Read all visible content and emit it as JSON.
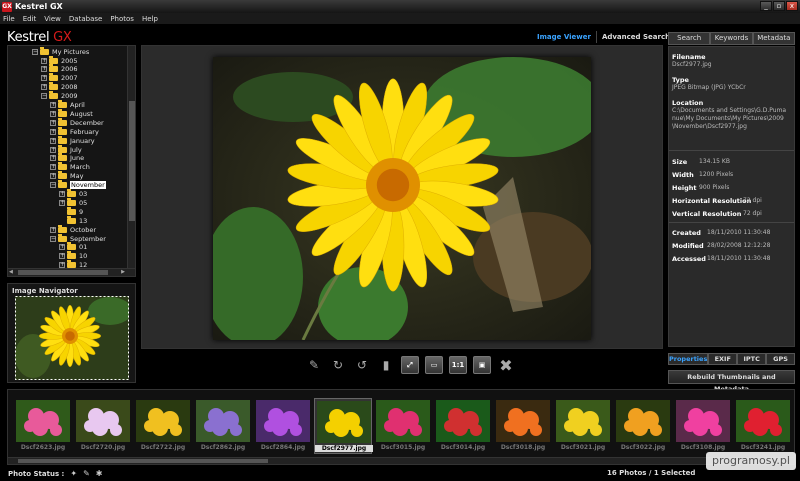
{
  "window": {
    "title": "Kestrel GX",
    "icon_text": "GX",
    "controls": [
      "_",
      "▫",
      "x"
    ]
  },
  "menu": [
    "File",
    "Edit",
    "View",
    "Database",
    "Photos",
    "Help"
  ],
  "logo": {
    "main": "Kestrel ",
    "accent": "GX"
  },
  "view_tabs": [
    {
      "label": "Image Viewer",
      "active": true
    },
    {
      "label": "Advanced Search",
      "active": false
    }
  ],
  "tree": {
    "root": "My Pictures",
    "items": [
      {
        "label": "2005",
        "level": 1,
        "exp": "+"
      },
      {
        "label": "2006",
        "level": 1,
        "exp": "+"
      },
      {
        "label": "2007",
        "level": 1,
        "exp": "+"
      },
      {
        "label": "2008",
        "level": 1,
        "exp": "+"
      },
      {
        "label": "2009",
        "level": 1,
        "exp": "−"
      },
      {
        "label": "April",
        "level": 2,
        "exp": "+"
      },
      {
        "label": "August",
        "level": 2,
        "exp": "+"
      },
      {
        "label": "December",
        "level": 2,
        "exp": "+"
      },
      {
        "label": "February",
        "level": 2,
        "exp": "+"
      },
      {
        "label": "January",
        "level": 2,
        "exp": "+"
      },
      {
        "label": "July",
        "level": 2,
        "exp": "+"
      },
      {
        "label": "June",
        "level": 2,
        "exp": "+"
      },
      {
        "label": "March",
        "level": 2,
        "exp": "+"
      },
      {
        "label": "May",
        "level": 2,
        "exp": "+"
      },
      {
        "label": "November",
        "level": 2,
        "exp": "−",
        "selected": true
      },
      {
        "label": "03",
        "level": 3,
        "exp": "+"
      },
      {
        "label": "05",
        "level": 3,
        "exp": "+"
      },
      {
        "label": "9",
        "level": 3,
        "exp": ""
      },
      {
        "label": "13",
        "level": 3,
        "exp": ""
      },
      {
        "label": "October",
        "level": 2,
        "exp": "+"
      },
      {
        "label": "September",
        "level": 2,
        "exp": "−"
      },
      {
        "label": "01",
        "level": 3,
        "exp": "+"
      },
      {
        "label": "10",
        "level": 3,
        "exp": "+"
      },
      {
        "label": "12",
        "level": 3,
        "exp": "+"
      }
    ]
  },
  "navigator": {
    "title": "Image Navigator"
  },
  "right_tabs": [
    "Search",
    "Keywords",
    "Metadata"
  ],
  "properties": {
    "filename_label": "Filename",
    "filename": "Dscf2977.jpg",
    "type_label": "Type",
    "type": "JPEG Bitmap (JPG) YCbCr",
    "location_label": "Location",
    "location": "C:\\Documents and Settings\\G.D.Pumanue\\My Documents\\My Pictures\\2009\\November\\Dscf2977.jpg",
    "size_label": "Size",
    "size": "134.15 KB",
    "width_label": "Width",
    "width": "1200 Pixels",
    "height_label": "Height",
    "height": "900 Pixels",
    "hres_label": "Horizontal Resolution",
    "hres": "72 dpi",
    "vres_label": "Vertical Resolution",
    "vres": "72 dpi",
    "created_label": "Created",
    "created": "18/11/2010 11:30:48",
    "modified_label": "Modified",
    "modified": "28/02/2008 12:12:28",
    "accessed_label": "Accessed",
    "accessed": "18/11/2010 11:30:48"
  },
  "bottom_tabs": [
    {
      "label": "Properties",
      "active": true
    },
    {
      "label": "EXIF",
      "active": false
    },
    {
      "label": "IPTC",
      "active": false
    },
    {
      "label": "GPS",
      "active": false
    }
  ],
  "rebuild_label": "Rebuild Thumbnails and Metadata",
  "toolbar": {
    "one_to_one": "1:1"
  },
  "thumbnails": [
    {
      "caption": "Dscf2623.jpg",
      "colors": [
        "#e85a9a",
        "#2f5a1a"
      ]
    },
    {
      "caption": "Dscf2720.jpg",
      "colors": [
        "#e8c8f0",
        "#3a4a1a"
      ]
    },
    {
      "caption": "Dscf2722.jpg",
      "colors": [
        "#f0c020",
        "#2a3a10"
      ]
    },
    {
      "caption": "Dscf2862.jpg",
      "colors": [
        "#8a70d0",
        "#3a5a2a"
      ]
    },
    {
      "caption": "Dscf2864.jpg",
      "colors": [
        "#b050e0",
        "#4a2a6a"
      ]
    },
    {
      "caption": "Dscf2977.jpg",
      "colors": [
        "#f4d000",
        "#2a4a1a"
      ],
      "selected": true
    },
    {
      "caption": "Dscf3015.jpg",
      "colors": [
        "#e03070",
        "#2a5a1a"
      ]
    },
    {
      "caption": "Dscf3014.jpg",
      "colors": [
        "#d03030",
        "#1a5a1a"
      ]
    },
    {
      "caption": "Dscf3018.jpg",
      "colors": [
        "#f07020",
        "#3a2a10"
      ]
    },
    {
      "caption": "Dscf3021.jpg",
      "colors": [
        "#f0d020",
        "#3a5a1a"
      ]
    },
    {
      "caption": "Dscf3022.jpg",
      "colors": [
        "#f0a020",
        "#2a3a10"
      ]
    },
    {
      "caption": "Dscf3108.jpg",
      "colors": [
        "#f040a0",
        "#5a2a4a"
      ]
    },
    {
      "caption": "Dscf3241.jpg",
      "colors": [
        "#e02030",
        "#2a5a1a"
      ]
    }
  ],
  "status": {
    "label": "Photo Status :",
    "count": "16 Photos / 1 Selected"
  },
  "watermark": "programosy.pl"
}
